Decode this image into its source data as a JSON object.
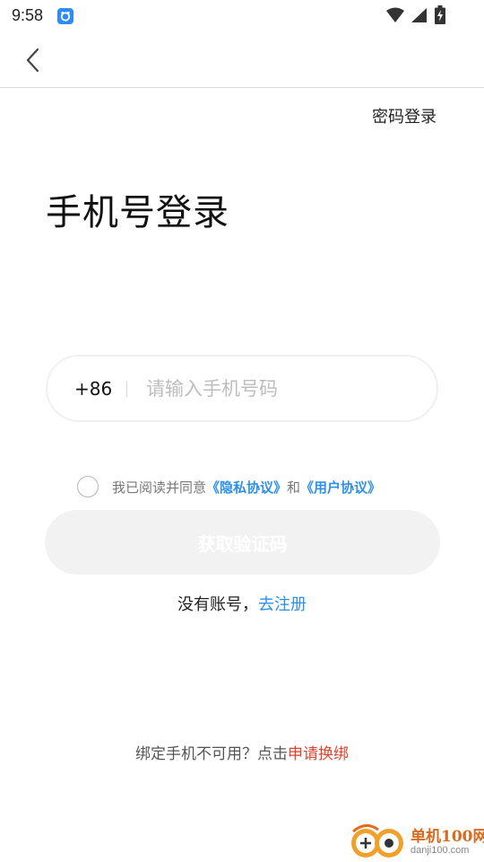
{
  "status_bar": {
    "time": "9:58",
    "icons": [
      "app-notification-icon",
      "wifi-icon",
      "signal-icon",
      "battery-charging-icon"
    ]
  },
  "nav": {
    "back_icon": "chevron-left-icon"
  },
  "password_login_label": "密码登录",
  "title": "手机号登录",
  "phone_input": {
    "country_code": "+86",
    "value": "",
    "placeholder": "请输入手机号码"
  },
  "agreement": {
    "checked": false,
    "prefix": "我已阅读并同意",
    "privacy_link": "《隐私协议》",
    "conjunction": "和",
    "user_link": "《用户协议》"
  },
  "get_code_button": "获取验证码",
  "register": {
    "prompt": "没有账号，",
    "link": "去注册"
  },
  "rebind": {
    "prompt": "绑定手机不可用？点击",
    "link": "申请换绑"
  },
  "watermark": {
    "name": "单机100网",
    "url": "danji100.com"
  },
  "colors": {
    "link_blue": "#2e8fe8",
    "link_red": "#e2432e",
    "button_disabled_bg": "#f2f2f2",
    "watermark_orange": "#d96a1e"
  }
}
